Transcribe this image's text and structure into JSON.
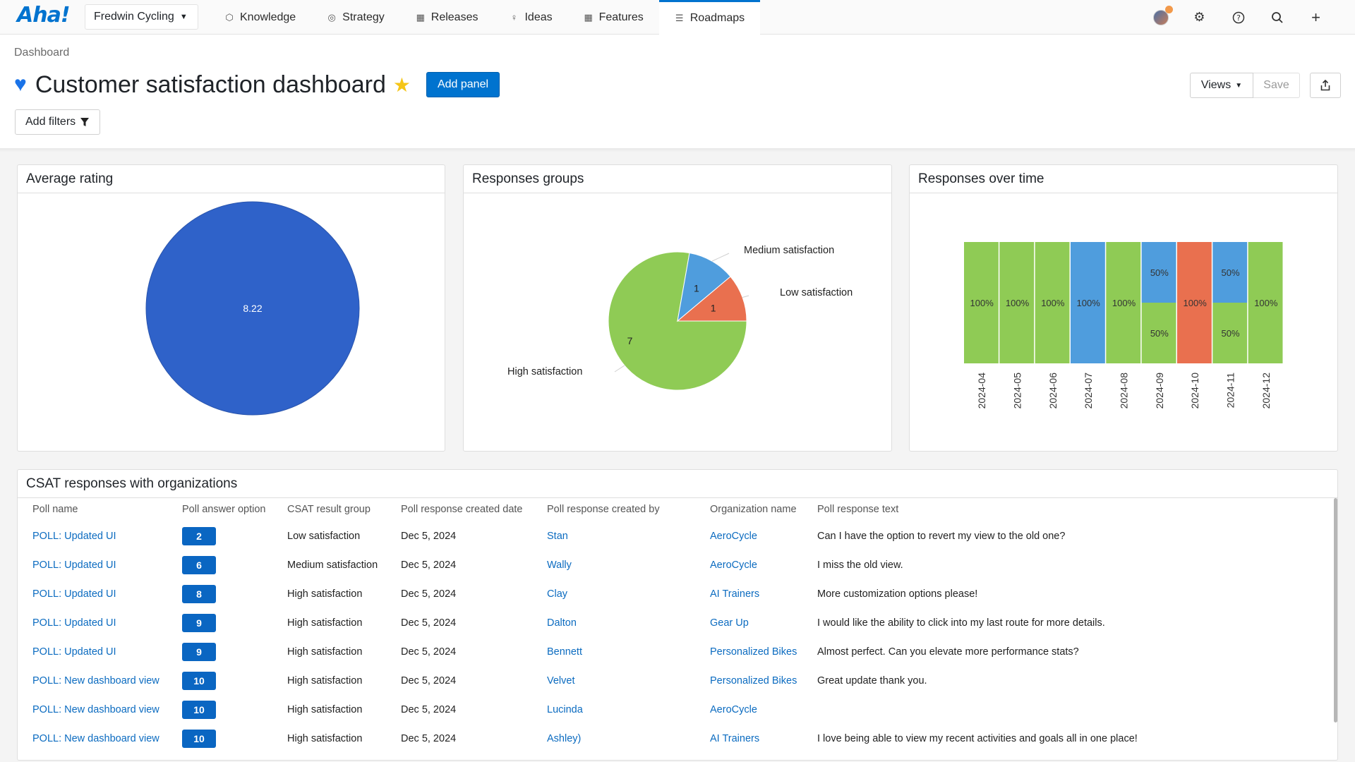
{
  "app": {
    "logo": "Aha!",
    "workspace": "Fredwin Cycling",
    "nav": [
      {
        "label": "Knowledge",
        "icon": "⬡"
      },
      {
        "label": "Strategy",
        "icon": "◎"
      },
      {
        "label": "Releases",
        "icon": "▦"
      },
      {
        "label": "Ideas",
        "icon": "♀"
      },
      {
        "label": "Features",
        "icon": "▦"
      },
      {
        "label": "Roadmaps",
        "icon": "☰"
      }
    ],
    "active_nav": "Roadmaps",
    "notification_color": "#f2994a",
    "accent_color": "#0073cf"
  },
  "header": {
    "breadcrumb": "Dashboard",
    "title": "Customer satisfaction dashboard",
    "add_panel": "Add panel",
    "add_filters": "Add filters",
    "views": "Views",
    "save": "Save"
  },
  "panels": {
    "average_rating": {
      "title": "Average rating"
    },
    "responses_groups": {
      "title": "Responses groups"
    },
    "responses_over_time": {
      "title": "Responses over time"
    },
    "csat_table": {
      "title": "CSAT responses with organizations"
    }
  },
  "chart_data": [
    {
      "type": "pie",
      "title": "Average rating",
      "slices": [
        {
          "label": "8.22",
          "value": 8.22,
          "color": "#2f62c9"
        }
      ]
    },
    {
      "type": "pie",
      "title": "Responses groups",
      "slices": [
        {
          "name": "High satisfaction",
          "value": 7,
          "color": "#8fcb55"
        },
        {
          "name": "Medium satisfaction",
          "value": 1,
          "color": "#4f9ddd"
        },
        {
          "name": "Low satisfaction",
          "value": 1,
          "color": "#e9704f"
        }
      ]
    },
    {
      "type": "bar",
      "stacked": "percent",
      "title": "Responses over time",
      "categories": [
        "2024-04",
        "2024-05",
        "2024-06",
        "2024-07",
        "2024-08",
        "2024-09",
        "2024-10",
        "2024-11",
        "2024-12"
      ],
      "series": [
        {
          "color": "#8fcb55",
          "values": [
            100,
            100,
            100,
            0,
            100,
            50,
            0,
            50,
            100
          ]
        },
        {
          "color": "#4f9ddd",
          "values": [
            0,
            0,
            0,
            100,
            0,
            50,
            0,
            50,
            0
          ]
        },
        {
          "color": "#e9704f",
          "values": [
            0,
            0,
            0,
            0,
            0,
            0,
            100,
            0,
            0
          ]
        }
      ]
    }
  ],
  "table": {
    "columns": [
      "Poll name",
      "Poll answer option",
      "CSAT result group",
      "Poll response created date",
      "Poll response created by",
      "Organization name",
      "Poll response text"
    ],
    "rows": [
      [
        "POLL: Updated UI",
        "2",
        "Low satisfaction",
        "Dec 5, 2024",
        "Stan",
        "AeroCycle",
        "Can I have the option to revert my view to the old one?"
      ],
      [
        "POLL: Updated UI",
        "6",
        "Medium satisfaction",
        "Dec 5, 2024",
        "Wally",
        "AeroCycle",
        "I miss the old view."
      ],
      [
        "POLL: Updated UI",
        "8",
        "High satisfaction",
        "Dec 5, 2024",
        "Clay",
        "AI Trainers",
        "More customization options please!"
      ],
      [
        "POLL: Updated UI",
        "9",
        "High satisfaction",
        "Dec 5, 2024",
        "Dalton",
        "Gear Up",
        "I would like the ability to click into my last route for more details."
      ],
      [
        "POLL: Updated UI",
        "9",
        "High satisfaction",
        "Dec 5, 2024",
        "Bennett",
        "Personalized Bikes",
        "Almost perfect. Can you elevate more performance stats?"
      ],
      [
        "POLL: New dashboard view",
        "10",
        "High satisfaction",
        "Dec 5, 2024",
        "Velvet",
        "Personalized Bikes",
        "Great update thank you."
      ],
      [
        "POLL: New dashboard view",
        "10",
        "High satisfaction",
        "Dec 5, 2024",
        "Lucinda",
        "AeroCycle",
        ""
      ],
      [
        "POLL: New dashboard view",
        "10",
        "High satisfaction",
        "Dec 5, 2024",
        "Ashley)",
        "AI Trainers",
        "I love being able to view my recent activities and goals all in one place!"
      ]
    ]
  }
}
